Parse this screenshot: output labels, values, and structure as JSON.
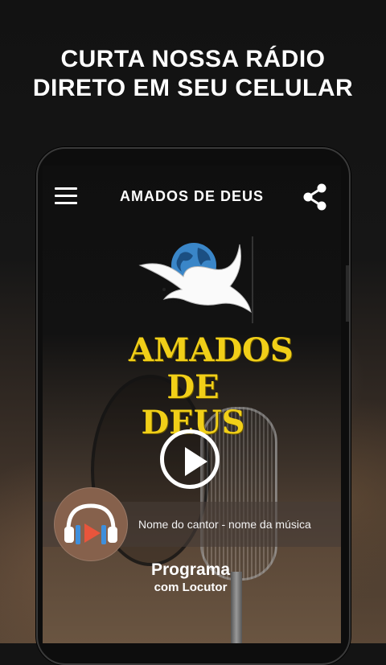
{
  "promo": {
    "headline_line1": "CURTA NOSSA RÁDIO",
    "headline_line2": "DIRETO EM SEU CELULAR"
  },
  "appbar": {
    "title": "AMADOS DE DEUS",
    "menu_icon": "hamburger-menu-icon",
    "share_icon": "share-icon"
  },
  "logo": {
    "line1": "AMADOS",
    "line2": "DE DEUS",
    "emblem": "dove-with-globe-icon",
    "text_color": "#f1cf18"
  },
  "player": {
    "play_icon": "play-icon",
    "now_playing": "Nome do cantor - nome da música",
    "album_icon": "headphones-play-icon",
    "program_title": "Programa",
    "program_subtitle": "com Locutor"
  }
}
